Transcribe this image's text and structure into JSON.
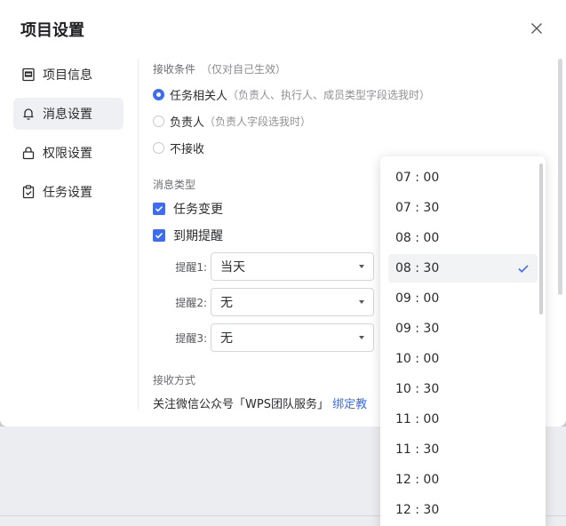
{
  "dialog": {
    "title": "项目设置"
  },
  "sidebar": {
    "items": [
      {
        "label": "项目信息",
        "icon": "info-card-icon",
        "active": false
      },
      {
        "label": "消息设置",
        "icon": "bell-icon",
        "active": true
      },
      {
        "label": "权限设置",
        "icon": "lock-icon",
        "active": false
      },
      {
        "label": "任务设置",
        "icon": "clipboard-check-icon",
        "active": false
      }
    ]
  },
  "receive_conditions": {
    "label": "接收条件",
    "hint": "（仅对自己生效）",
    "options": [
      {
        "label": "任务相关人",
        "hint": "（负责人、执行人、成员类型字段选我时）",
        "checked": true
      },
      {
        "label": "负责人",
        "hint": "（负责人字段选我时）",
        "checked": false
      },
      {
        "label": "不接收",
        "hint": "",
        "checked": false
      }
    ]
  },
  "message_types": {
    "label": "消息类型",
    "items": [
      {
        "label": "任务变更",
        "checked": true
      },
      {
        "label": "到期提醒",
        "checked": true
      }
    ]
  },
  "reminders": [
    {
      "label": "提醒1:",
      "value": "当天"
    },
    {
      "label": "提醒2:",
      "value": "无"
    },
    {
      "label": "提醒3:",
      "value": "无"
    }
  ],
  "receive_method": {
    "label": "接收方式",
    "text": "关注微信公众号「WPS团队服务」",
    "link": "绑定教"
  },
  "time_dropdown": {
    "selected": "08 : 30",
    "options": [
      "07 : 00",
      "07 : 30",
      "08 : 00",
      "08 : 30",
      "09 : 00",
      "09 : 30",
      "10 : 00",
      "10 : 30",
      "11 : 00",
      "11 : 30",
      "12 : 00",
      "12 : 30"
    ]
  },
  "colors": {
    "accent": "#3d6cf2",
    "text": "#2a2b2e",
    "muted": "#8f9196"
  }
}
